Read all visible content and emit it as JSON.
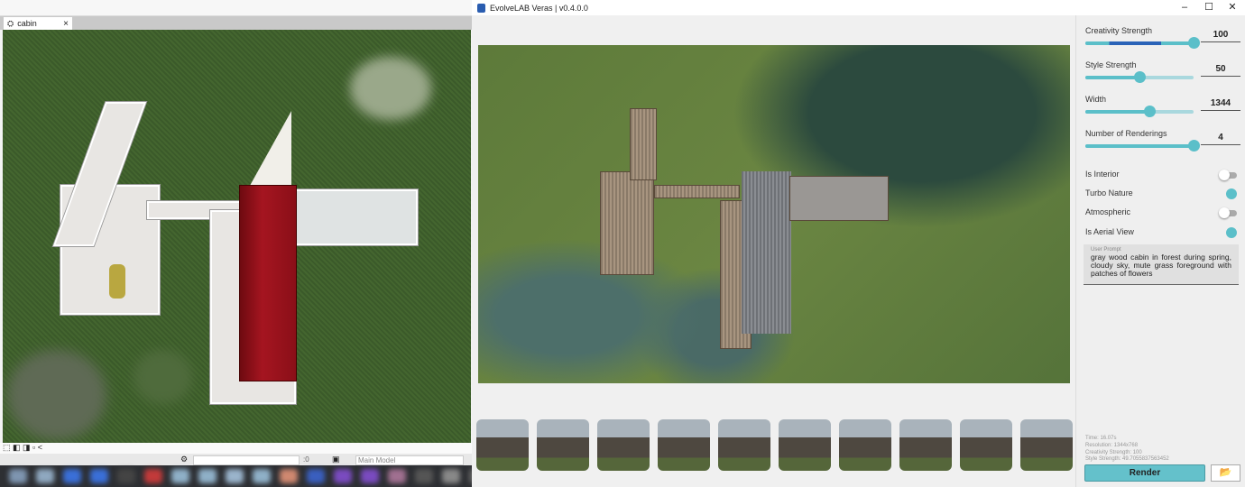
{
  "revit": {
    "tab_label": "cabin",
    "tab_close": "×",
    "view_model": "Main Model",
    "zero_count": ":0",
    "nav_back": "<"
  },
  "veras": {
    "title": "EvolveLAB Veras | v0.4.0.0",
    "window_buttons": {
      "minimize": "–",
      "maximize": "☐",
      "close": "✕"
    },
    "thumbnail_count": 10,
    "settings": {
      "creativity_strength": {
        "label": "Creativity Strength",
        "value": "100",
        "fraction": 1.0
      },
      "style_strength": {
        "label": "Style Strength",
        "value": "50",
        "fraction": 0.5
      },
      "width": {
        "label": "Width",
        "value": "1344",
        "fraction": 0.6
      },
      "number_of_renderings": {
        "label": "Number of Renderings",
        "value": "4",
        "fraction": 1.0
      },
      "is_interior": {
        "label": "Is Interior",
        "on": false
      },
      "turbo_nature": {
        "label": "Turbo Nature",
        "on": true
      },
      "atmospheric": {
        "label": "Atmospheric",
        "on": false
      },
      "is_aerial_view": {
        "label": "Is Aerial View",
        "on": true
      }
    },
    "prompt": {
      "label": "User Prompt",
      "value": "gray wood cabin in forest during spring, cloudy sky, mute grass foreground with patches of flowers"
    },
    "stats": {
      "time": "Time: 16.07s",
      "resolution": "Resolution: 1344x768",
      "creativity": "Creativity Strength: 100",
      "style": "Style Strength: 49.7055837563452"
    },
    "render_label": "Render",
    "folder_icon": "📂",
    "accent": "#5bbfc9"
  }
}
